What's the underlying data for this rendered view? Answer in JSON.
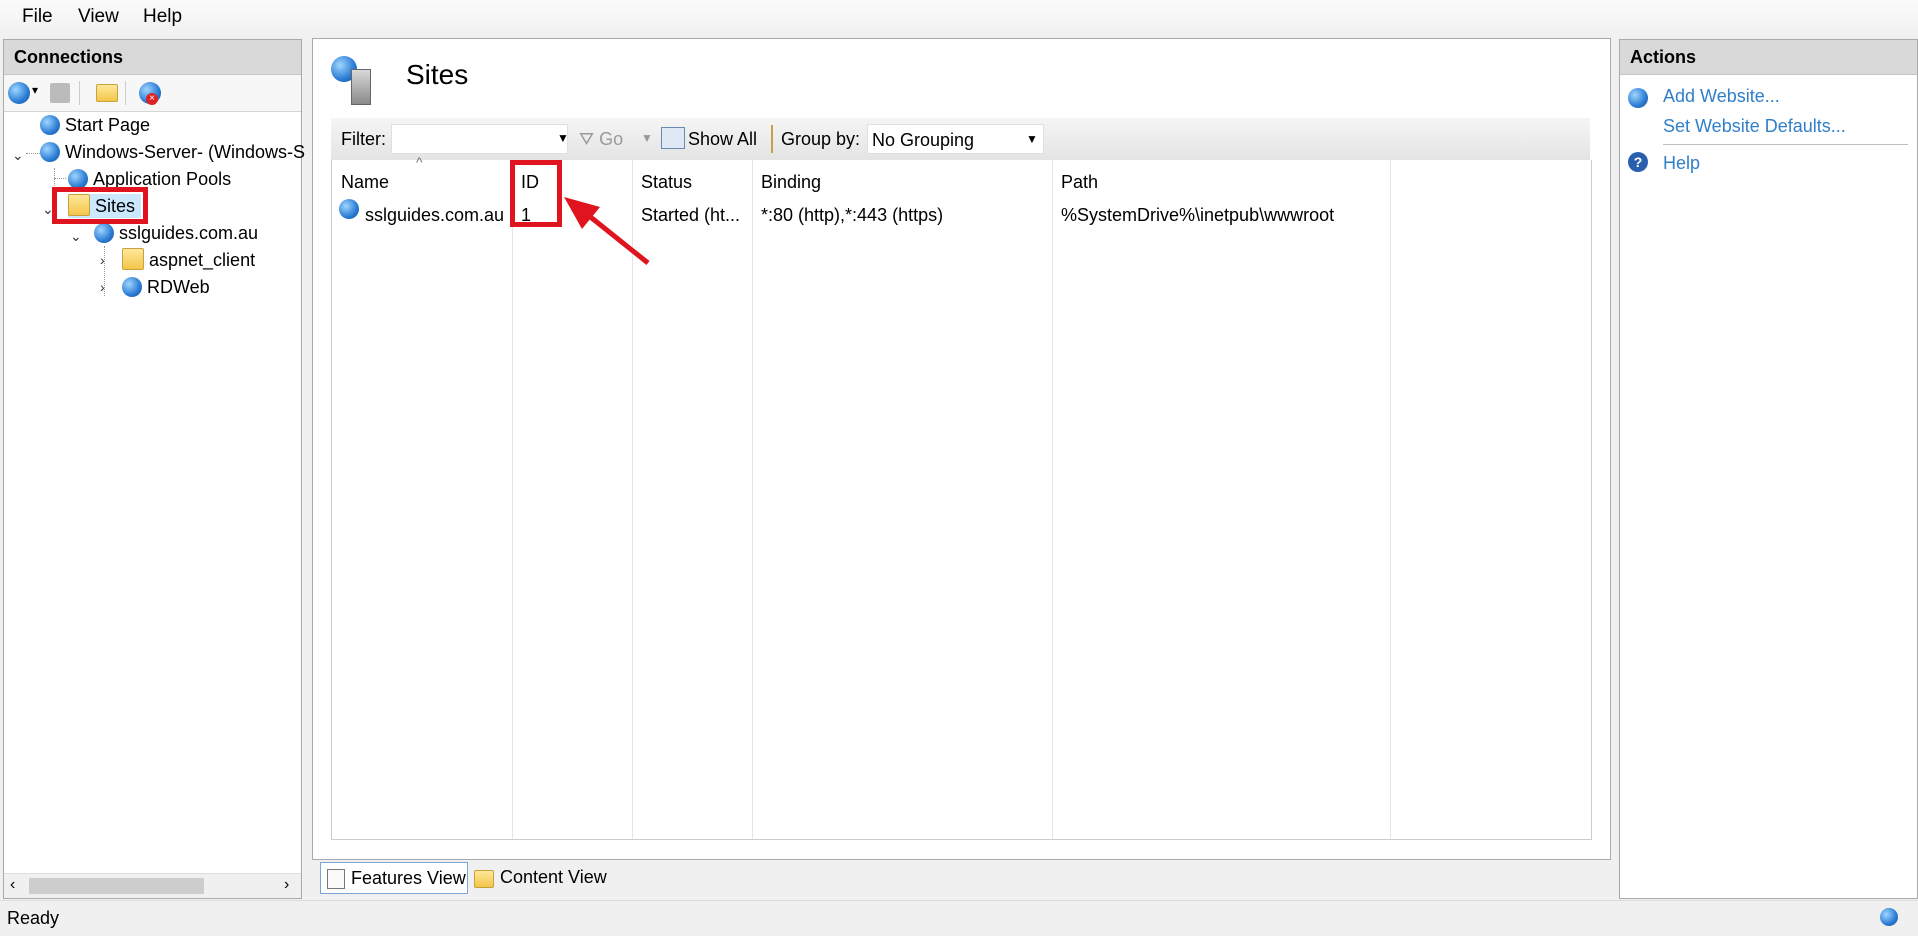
{
  "menu": {
    "file": "File",
    "view": "View",
    "help": "Help"
  },
  "connections": {
    "title": "Connections",
    "tree": {
      "start_page": "Start Page",
      "server": "Windows-Server- (Windows-S",
      "app_pools": "Application Pools",
      "sites": "Sites",
      "site1": "sslguides.com.au",
      "child1": "aspnet_client",
      "child2": "RDWeb"
    }
  },
  "main": {
    "title": "Sites",
    "filter_label": "Filter:",
    "filter_value": "",
    "go_label": "Go",
    "show_all_label": "Show All",
    "group_by_label": "Group by:",
    "group_by_value": "No Grouping",
    "columns": {
      "name": "Name",
      "id": "ID",
      "status": "Status",
      "binding": "Binding",
      "path": "Path"
    },
    "rows": [
      {
        "name": "sslguides.com.au",
        "id": "1",
        "status": "Started (ht...",
        "binding": "*:80 (http),*:443 (https)",
        "path": "%SystemDrive%\\inetpub\\wwwroot"
      }
    ]
  },
  "view_tabs": {
    "features": "Features View",
    "content": "Content View"
  },
  "actions": {
    "title": "Actions",
    "add_website": "Add Website...",
    "set_defaults": "Set Website Defaults...",
    "help": "Help"
  },
  "status": {
    "text": "Ready"
  },
  "colors": {
    "highlight": "#e0141e",
    "link": "#2f7fc9"
  }
}
